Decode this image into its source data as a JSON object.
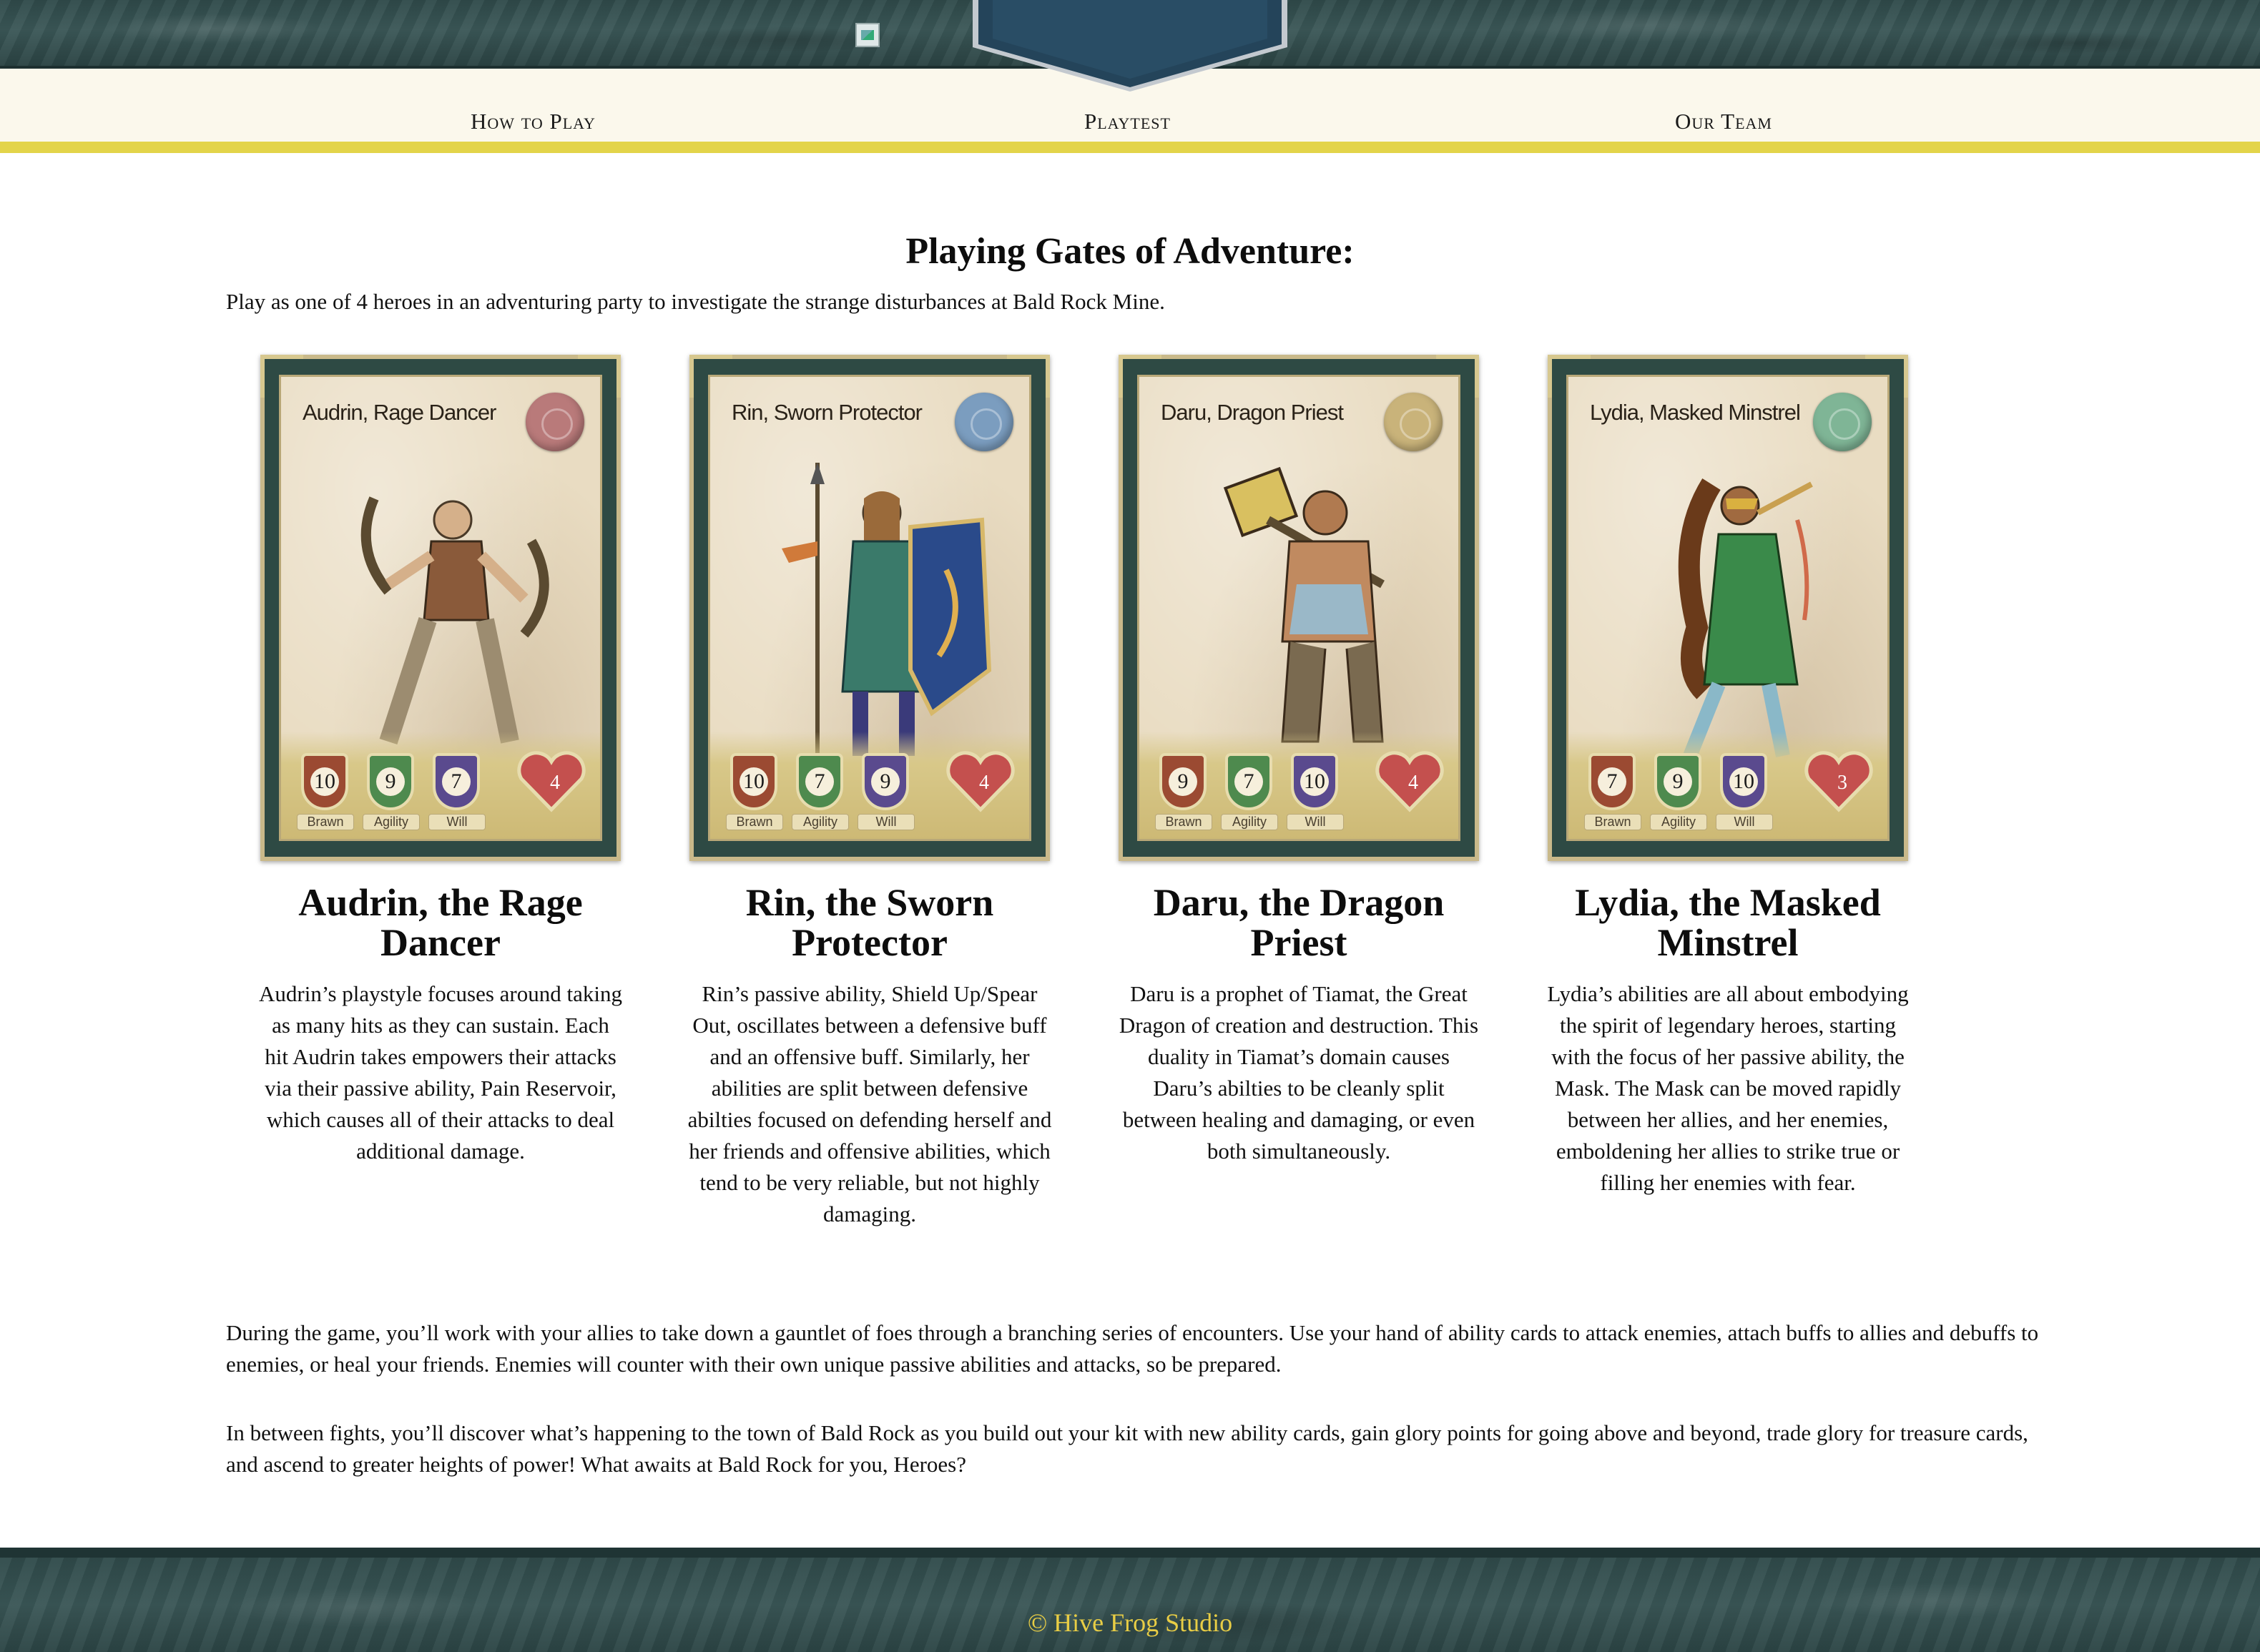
{
  "header": {
    "logo_alt": "",
    "nav": [
      {
        "label": "How to Play"
      },
      {
        "label": "Playtest"
      },
      {
        "label": "Our Team"
      }
    ]
  },
  "colors": {
    "marble": "#2f4a4a",
    "nav_bg": "#fbf8ec",
    "accent_yellow": "#e3d44a",
    "banner": "#24445a",
    "footer_text": "#e8cd45"
  },
  "main": {
    "title": "Playing Gates of Adventure:",
    "intro": "Play as one of 4 heroes in an adventuring party to investigate the strange disturbances at Bald Rock Mine.",
    "heroes": [
      {
        "card_name": "Audrin, Rage Dancer",
        "seal_color": "#b97a7a",
        "stats": {
          "brawn": "10",
          "agility": "9",
          "will": "7",
          "health": "4"
        },
        "title": "Audrin, the Rage Dancer",
        "description": "Audrin’s playstyle focuses around taking as many hits as they can sustain. Each hit Audrin takes empowers their attacks via their passive ability, Pain Reservoir, which causes all of their attacks to deal additional damage."
      },
      {
        "card_name": "Rin, Sworn Protector",
        "seal_color": "#7b9dbf",
        "stats": {
          "brawn": "10",
          "agility": "7",
          "will": "9",
          "health": "4"
        },
        "title": "Rin, the Sworn Protector",
        "description": "Rin’s passive ability, Shield Up/Spear Out, oscillates between a defensive buff and an offensive buff. Similarly, her abilities are split between defensive abilties focused on defending herself and her friends and offensive abilities, which tend to be very reliable, but not highly damaging."
      },
      {
        "card_name": "Daru, Dragon Priest",
        "seal_color": "#c9b37a",
        "stats": {
          "brawn": "9",
          "agility": "7",
          "will": "10",
          "health": "4"
        },
        "title": "Daru, the Dragon Priest",
        "description": "Daru is a prophet of Tiamat, the Great Dragon of creation and destruction. This duality in Tiamat’s domain causes Daru’s abilties to be cleanly split between healing and damaging, or even both simultaneously."
      },
      {
        "card_name": "Lydia, Masked Minstrel",
        "seal_color": "#7fb596",
        "stats": {
          "brawn": "7",
          "agility": "9",
          "will": "10",
          "health": "3"
        },
        "title": "Lydia, the Masked Minstrel",
        "description": "Lydia’s abilities are all about embodying the spirit of legendary heroes, starting with the focus of her passive ability, the Mask. The Mask can be moved rapidly between her allies, and her enemies, emboldening her allies to strike true or filling her enemies with fear."
      }
    ],
    "stat_labels": {
      "brawn": "Brawn",
      "agility": "Agility",
      "will": "Will"
    },
    "paragraph_1": "During the game, you’ll work with your allies to take down a gauntlet of foes through a branching series of encounters. Use your hand of ability cards to attack enemies, attach buffs to allies and debuffs to enemies, or heal your friends. Enemies will counter with their own unique passive abilities and attacks, so be prepared.",
    "paragraph_2": "In between fights, you’ll discover what’s happening to the town of Bald Rock as you build out your kit with new ability cards, gain glory points for going above and beyond, trade glory for treasure cards, and ascend to greater heights of power! What awaits at Bald Rock for you, Heroes?"
  },
  "footer": {
    "copyright": "© Hive Frog Studio"
  }
}
